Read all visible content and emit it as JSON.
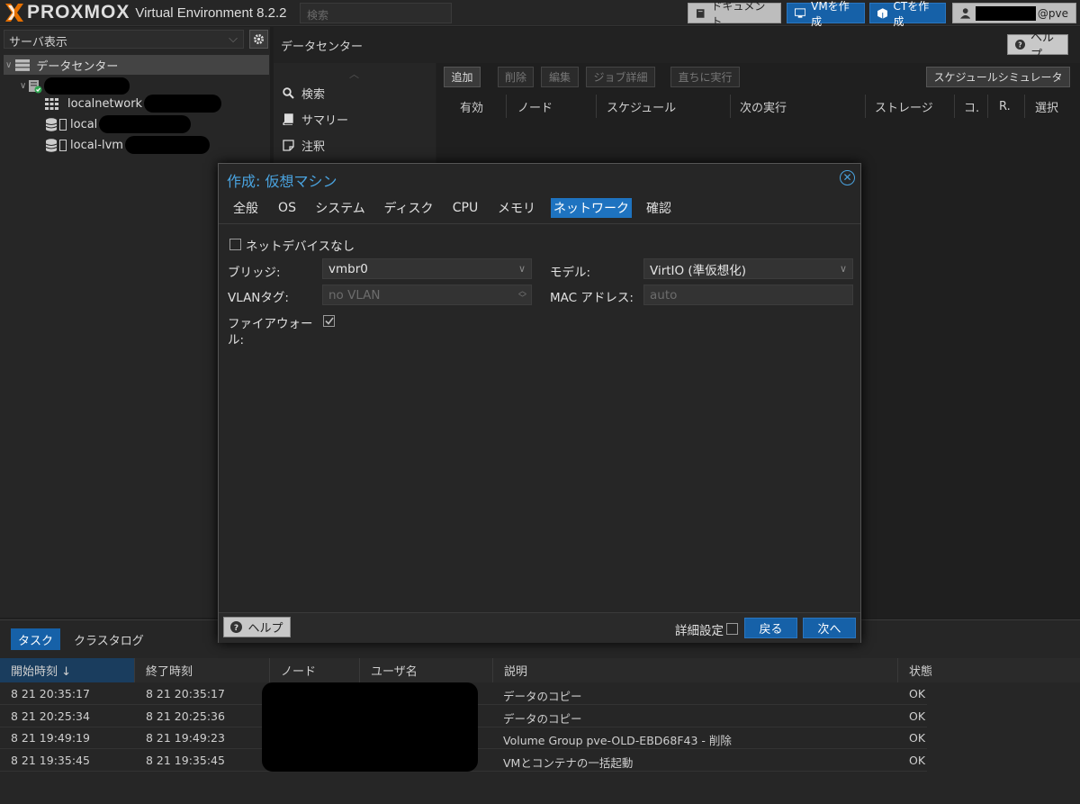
{
  "topbar": {
    "logo_word": "PROXMOX",
    "version": "Virtual Environment 8.2.2",
    "search_placeholder": "検索",
    "docs_label": "ドキュメント",
    "create_vm_label": "VMを作成",
    "create_ct_label": "CTを作成",
    "user_suffix": "@pve"
  },
  "sidebar": {
    "view_select": "サーバ表示",
    "tree": {
      "datacenter": "データセンター",
      "node_name": "",
      "items": [
        {
          "label": "localnetwork",
          "icon": "grid-icon"
        },
        {
          "label": "local",
          "icon": "storage-icon"
        },
        {
          "label": "local-lvm",
          "icon": "storage-icon"
        }
      ]
    }
  },
  "main": {
    "title": "データセンター",
    "help_label": "ヘルプ",
    "nav": [
      {
        "label": "検索",
        "icon": "search-icon"
      },
      {
        "label": "サマリー",
        "icon": "book-icon"
      },
      {
        "label": "注釈",
        "icon": "note-icon"
      }
    ],
    "toolbar": {
      "add": "追加",
      "delete": "削除",
      "edit": "編集",
      "job_detail": "ジョブ詳細",
      "run_now": "直ちに実行",
      "schedule_sim": "スケジュールシミュレータ"
    },
    "columns": [
      "有効",
      "ノード",
      "スケジュール",
      "次の実行",
      "ストレージ",
      "コ.",
      "R.",
      "選択"
    ]
  },
  "dialog": {
    "title": "作成: 仮想マシン",
    "tabs": [
      "全般",
      "OS",
      "システム",
      "ディスク",
      "CPU",
      "メモリ",
      "ネットワーク",
      "確認"
    ],
    "active_tab": "ネットワーク",
    "no_network_label": "ネットデバイスなし",
    "bridge_label": "ブリッジ:",
    "bridge_value": "vmbr0",
    "vlan_label": "VLANタグ:",
    "vlan_placeholder": "no VLAN",
    "firewall_label_1": "ファイアウォー",
    "firewall_label_2": "ル:",
    "firewall_checked": true,
    "model_label": "モデル:",
    "model_value": "VirtIO (準仮想化)",
    "mac_label": "MAC アドレス:",
    "mac_placeholder": "auto",
    "help_label": "ヘルプ",
    "advanced_label": "詳細設定",
    "back_label": "戻る",
    "next_label": "次へ"
  },
  "bottom": {
    "tabs": [
      "タスク",
      "クラスタログ"
    ],
    "active_tab": "タスク",
    "columns": [
      "開始時刻 ↓",
      "終了時刻",
      "ノード",
      "ユーザ名",
      "説明",
      "状態"
    ],
    "rows": [
      {
        "start": "8 21 20:35:17",
        "end": "8 21 20:35:17",
        "desc": "データのコピー",
        "status": "OK"
      },
      {
        "start": "8 21 20:25:34",
        "end": "8 21 20:25:36",
        "desc": "データのコピー",
        "status": "OK"
      },
      {
        "start": "8 21 19:49:19",
        "end": "8 21 19:49:23",
        "desc": "Volume Group pve-OLD-EBD68F43 - 削除",
        "status": "OK"
      },
      {
        "start": "8 21 19:35:45",
        "end": "8 21 19:35:45",
        "desc": "VMとコンテナの一括起動",
        "status": "OK"
      }
    ]
  },
  "colors": {
    "accent_blue": "#1661a8",
    "title_blue": "#4aa3df",
    "status_ok": "#2ea44f"
  }
}
